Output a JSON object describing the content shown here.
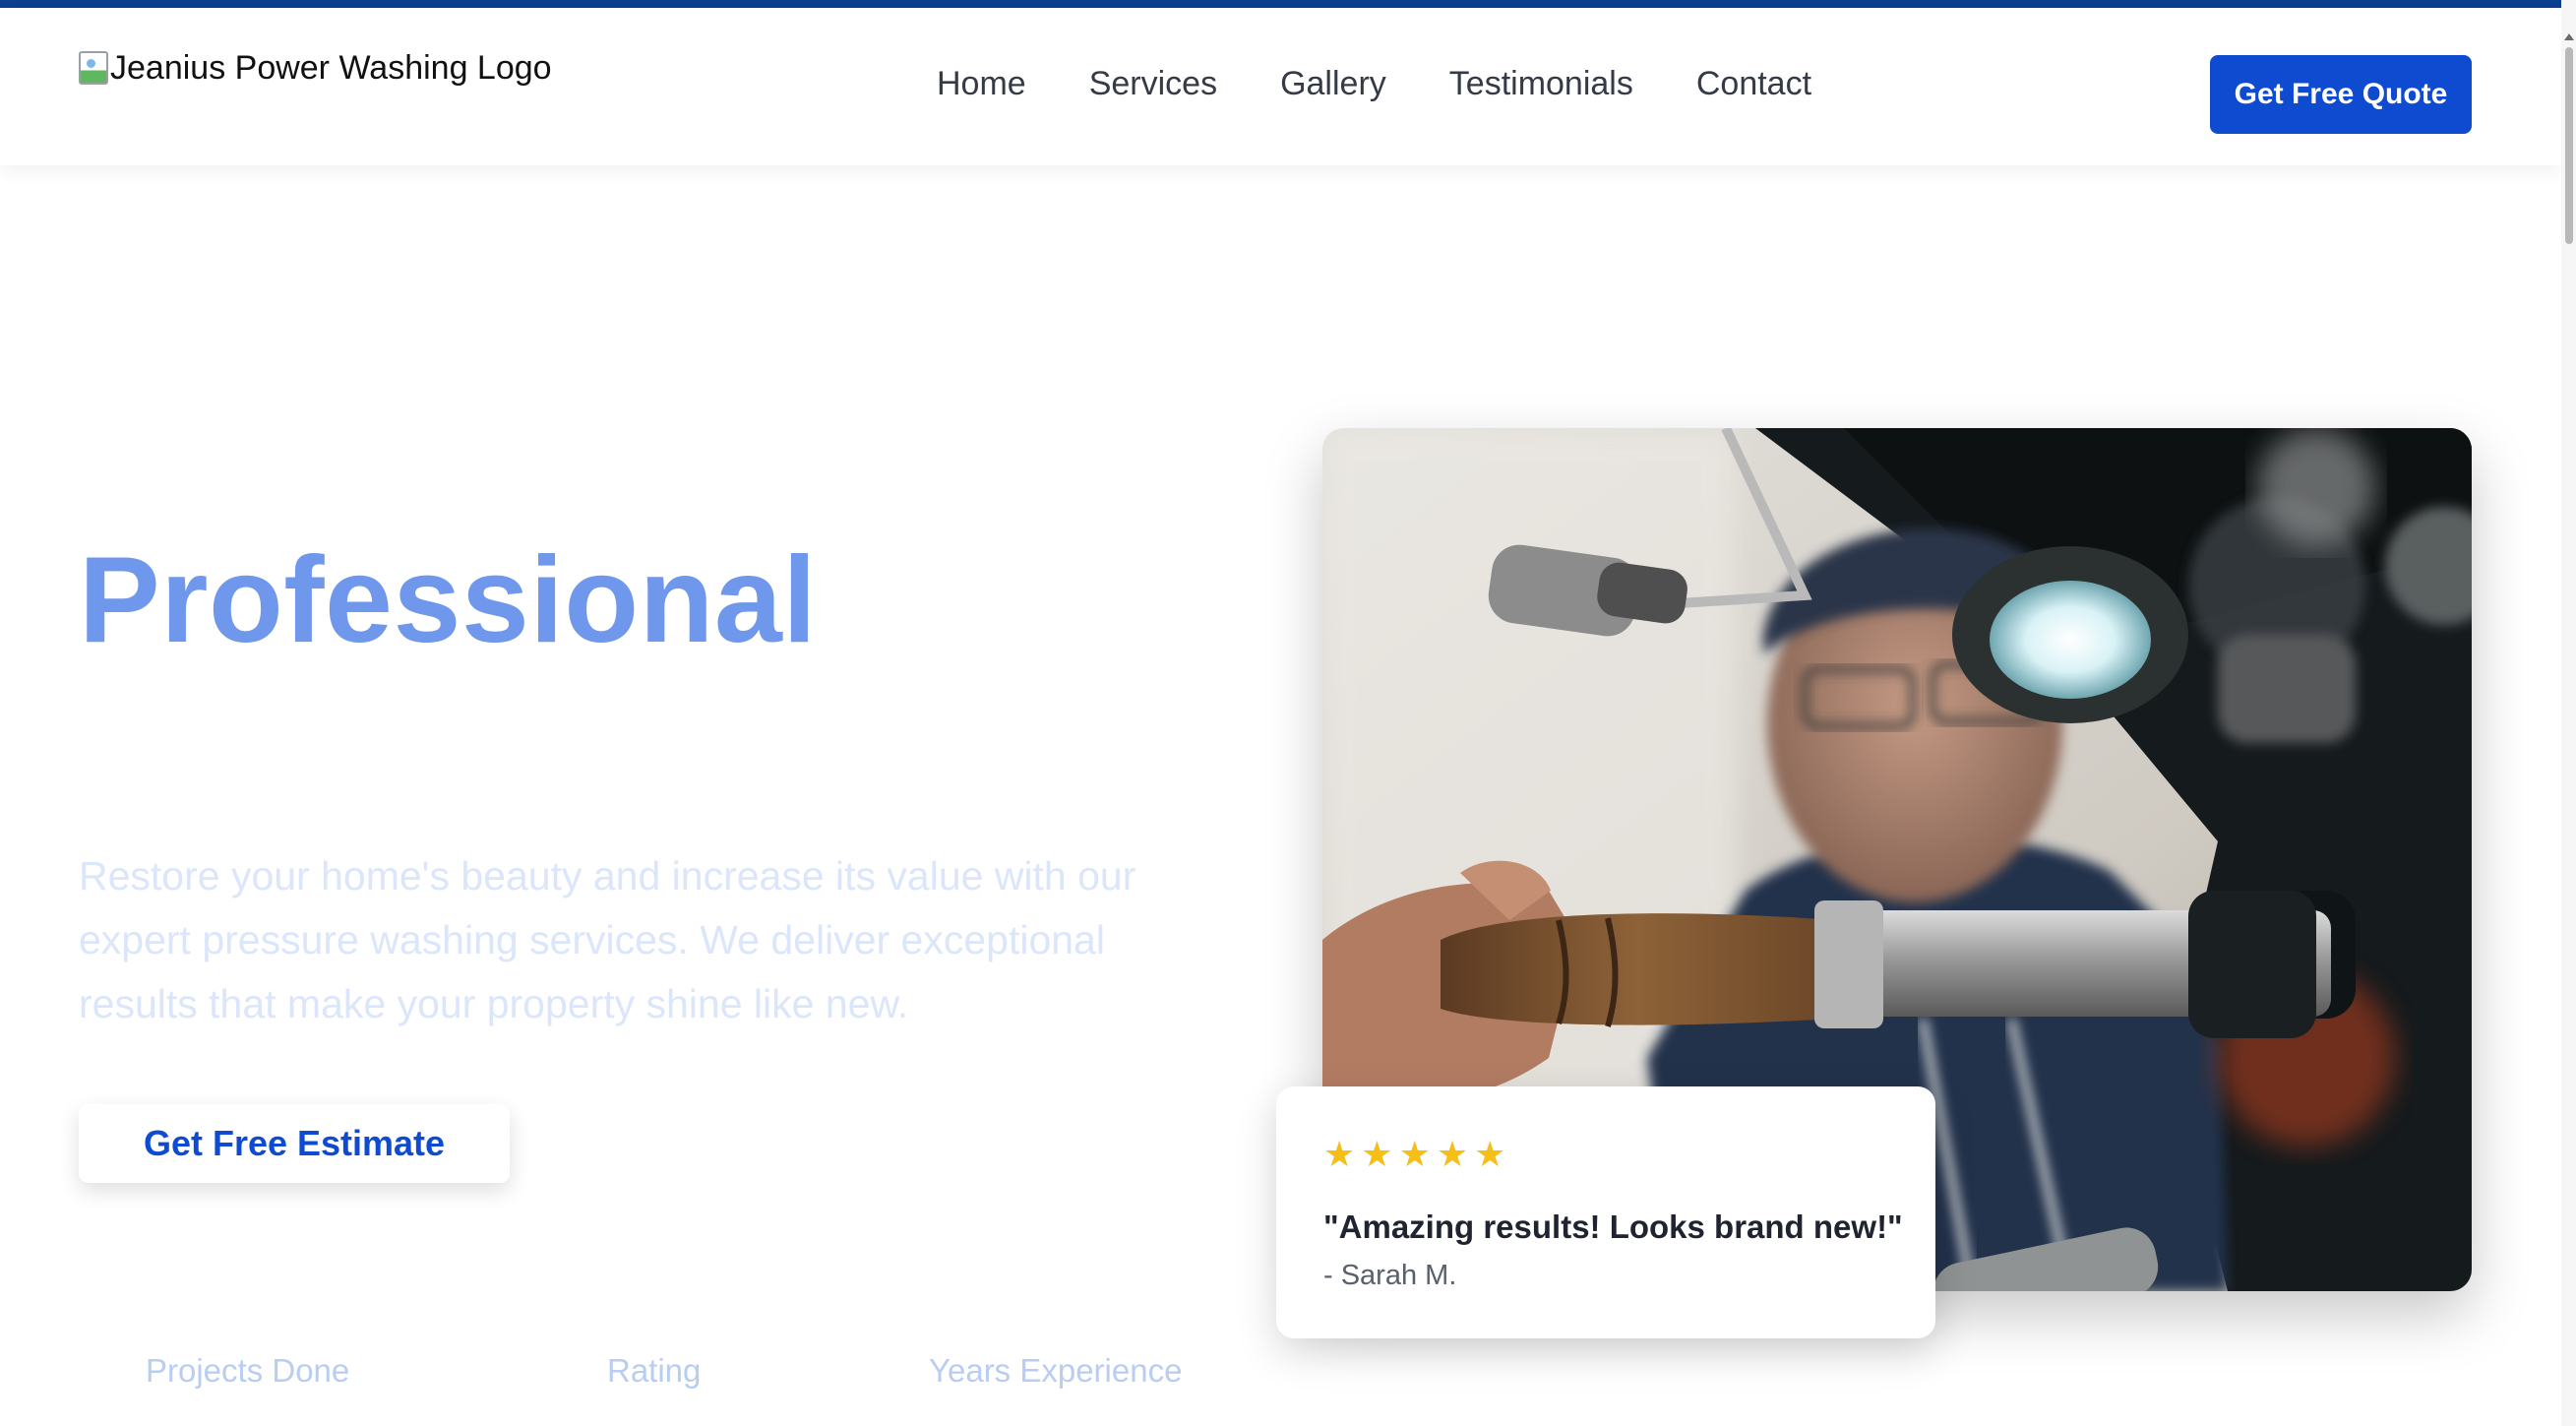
{
  "header": {
    "logo_alt": "Jeanius Power Washing Logo",
    "nav": {
      "home": "Home",
      "services": "Services",
      "gallery": "Gallery",
      "testimonials": "Testimonials",
      "contact": "Contact"
    },
    "cta_label": "Get Free Quote"
  },
  "hero": {
    "title": "Professional",
    "description": "Restore your home's beauty and increase its value with our expert pressure washing services. We deliver exceptional results that make your property shine like new.",
    "cta_label": "Get Free Estimate",
    "stats": {
      "projects_label": "Projects Done",
      "rating_label": "Rating",
      "years_label": "Years Experience"
    }
  },
  "review": {
    "stars": [
      "★",
      "★",
      "★",
      "★",
      "★"
    ],
    "quote": "\"Amazing results! Looks brand new!\"",
    "author": "- Sarah M."
  },
  "colors": {
    "brand_blue": "#0f4bd1",
    "top_strip": "#0b3f8f",
    "hero_title": "#6f97ec",
    "star_gold": "#f5be19"
  },
  "icons": {
    "logo": "broken-image-icon",
    "rating": "star-icon"
  }
}
